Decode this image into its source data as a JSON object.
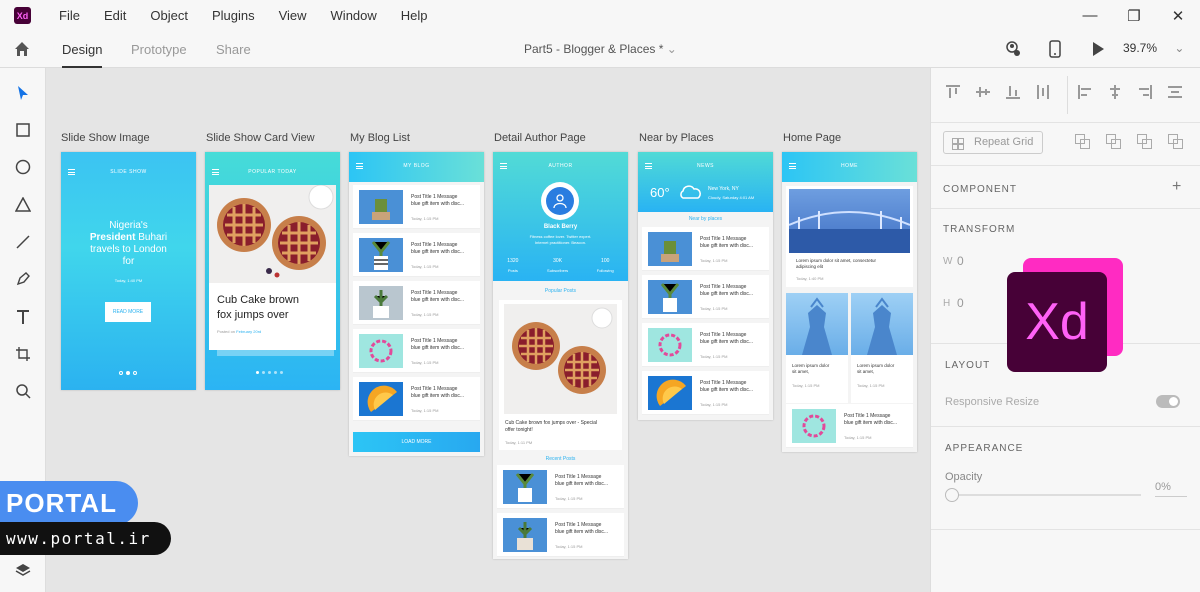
{
  "menu": [
    "File",
    "Edit",
    "Object",
    "Plugins",
    "View",
    "Window",
    "Help"
  ],
  "app_logo": "Xd",
  "tabs": {
    "design": "Design",
    "prototype": "Prototype",
    "share": "Share"
  },
  "doc_title": "Part5 - Blogger & Places *",
  "zoom": "39.7%",
  "artboards": {
    "slideshow": {
      "label": "Slide Show Image",
      "header": "SLIDE SHOW",
      "headline_1": "Nigeria's",
      "headline_bold": "President",
      "headline_2": "Buhari",
      "headline_3": "travels to London",
      "headline_4": "for",
      "date": "Today, 1:40 PM",
      "button": "READ MORE"
    },
    "cardview": {
      "label": "Slide Show Card View",
      "header": "POPULAR TODAY",
      "title_1": "Cub Cake brown",
      "title_2": "fox jumps over",
      "posted": "Posted on",
      "posted_date": "February 20rd"
    },
    "bloglist": {
      "label": "My Blog List",
      "header": "MY BLOG",
      "posts": [
        {
          "t1": "Post Title 1 Message",
          "t2": "blue gift item with disc...",
          "d": "Today, 1:15 PM"
        },
        {
          "t1": "Post Title 1 Message",
          "t2": "blue gift item with disc...",
          "d": "Today, 1:15 PM"
        },
        {
          "t1": "Post Title 1 Message",
          "t2": "blue gift item with disc...",
          "d": "Today, 1:15 PM"
        },
        {
          "t1": "Post Title 1 Message",
          "t2": "blue gift item with disc...",
          "d": "Today, 1:15 PM"
        },
        {
          "t1": "Post Title 1 Message",
          "t2": "blue gift item with disc...",
          "d": "Today, 1:15 PM"
        }
      ],
      "button": "LOAD MORE"
    },
    "author": {
      "label": "Detail Author Page",
      "header": "AUTHOR",
      "name": "Black Berry",
      "bio_1": "Fitness coffee lover. Twitter expert.",
      "bio_2": "Internet practitioner. Beacon.",
      "stats": [
        {
          "n": "1320",
          "l": "Posts"
        },
        {
          "n": "30K",
          "l": "Subscribers"
        },
        {
          "n": "100",
          "l": "Following"
        }
      ],
      "popular": "Popular Posts",
      "post_text_1": "Cub Cake brown fox jumps over - Special",
      "post_text_2": "offer tonight!",
      "post_date": "Today, 1:11 PM",
      "recent": "Recent Posts",
      "posts": [
        {
          "t1": "Post Title 1 Message",
          "t2": "blue gift item with disc...",
          "d": "Today, 1:15 PM"
        },
        {
          "t1": "Post Title 1 Message",
          "t2": "blue gift item with disc...",
          "d": "Today, 1:15 PM"
        }
      ]
    },
    "places": {
      "label": "Near by Places",
      "header": "NEWS",
      "temp": "60°",
      "city": "New York, NY",
      "weather": "Cloudy, Saturday 4:01 AM",
      "near": "Near by places",
      "posts": [
        {
          "t1": "Post Title 1 Message",
          "t2": "blue gift item with disc...",
          "d": "Today, 1:15 PM"
        },
        {
          "t1": "Post Title 1 Message",
          "t2": "blue gift item with disc...",
          "d": "Today, 1:15 PM"
        },
        {
          "t1": "Post Title 1 Message",
          "t2": "blue gift item with disc...",
          "d": "Today, 1:15 PM"
        },
        {
          "t1": "Post Title 1 Message",
          "t2": "blue gift item with disc...",
          "d": "Today, 1:15 PM"
        }
      ]
    },
    "home": {
      "label": "Home Page",
      "header": "HOME",
      "hero_text_1": "Lorem ipsum dolor sit amet, consectetur",
      "hero_text_2": "adipiscing elit",
      "hero_date": "Today, 1:40 PM",
      "small_1": "Lorem ipsum dolor",
      "small_2": "sit amet,",
      "small_date": "Today, 1:15 PM",
      "post": {
        "t1": "Post Title 1 Message",
        "t2": "blue gift item with disc...",
        "d": "Today, 1:15 PM"
      }
    }
  },
  "panel": {
    "repeat_grid": "Repeat Grid",
    "component": "COMPONENT",
    "transform": "TRANSFORM",
    "w_label": "W",
    "w_value": "0",
    "h_label": "H",
    "h_value": "0",
    "layout": "LAYOUT",
    "responsive": "Responsive Resize",
    "appearance": "APPEARANCE",
    "opacity": "Opacity",
    "opacity_value": "0%"
  },
  "xd_big_logo": "Xd",
  "watermark": {
    "brand": "PORTAL",
    "url": "www.portal.ir"
  }
}
